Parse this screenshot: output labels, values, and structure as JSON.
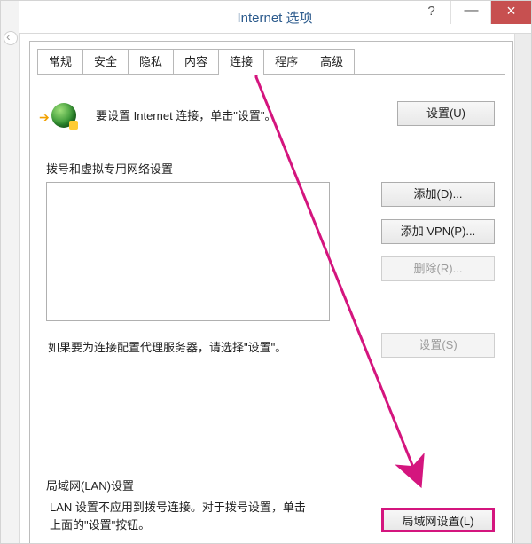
{
  "window": {
    "title": "Internet 选项",
    "help_btn": "?",
    "min_btn": "—",
    "close_btn": "×"
  },
  "tabs": {
    "items": [
      {
        "label": "常规"
      },
      {
        "label": "安全"
      },
      {
        "label": "隐私"
      },
      {
        "label": "内容"
      },
      {
        "label": "连接",
        "active": true
      },
      {
        "label": "程序"
      },
      {
        "label": "高级"
      }
    ]
  },
  "setup": {
    "text": "要设置 Internet 连接，单击\"设置\"。",
    "button": "设置(U)"
  },
  "dialup": {
    "group_label": "拨号和虚拟专用网络设置",
    "add_btn": "添加(D)...",
    "add_vpn_btn": "添加 VPN(P)...",
    "remove_btn": "删除(R)...",
    "proxy_note": "如果要为连接配置代理服务器，请选择\"设置\"。",
    "settings_btn": "设置(S)"
  },
  "lan": {
    "group_label": "局域网(LAN)设置",
    "note_line1": "LAN 设置不应用到拨号连接。对于拨号设置，单击",
    "note_line2": "上面的\"设置\"按钮。",
    "button": "局域网设置(L)"
  }
}
